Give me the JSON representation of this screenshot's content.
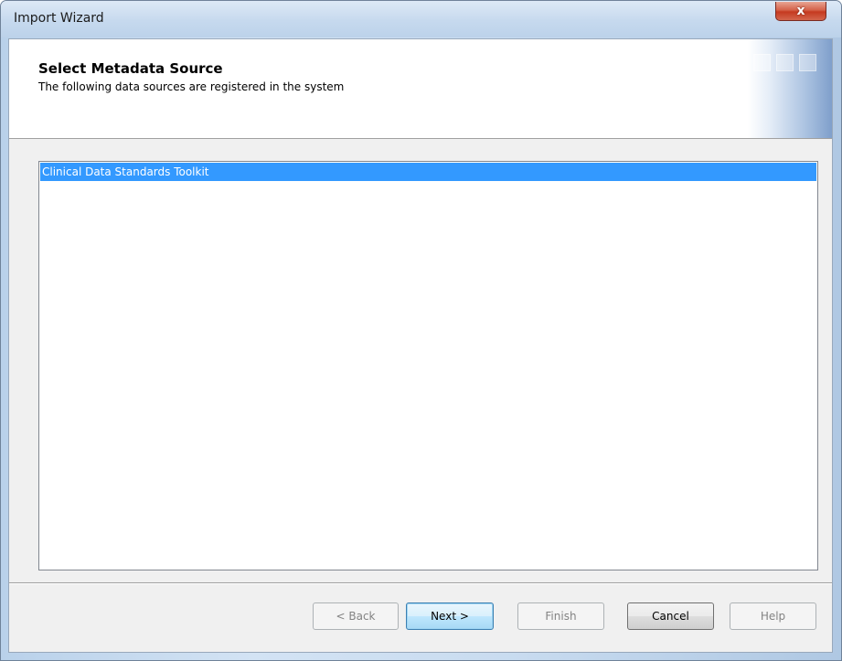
{
  "window": {
    "title": "Import Wizard",
    "close_glyph": "x"
  },
  "header": {
    "title": "Select Metadata Source",
    "subtitle": "The following data sources are registered in the system"
  },
  "sources": {
    "items": [
      {
        "label": "Clinical Data Standards Toolkit",
        "selected": true
      }
    ]
  },
  "buttons": {
    "back": {
      "label": "< Back",
      "enabled": false
    },
    "next": {
      "label": "Next >",
      "enabled": true,
      "default": true
    },
    "finish": {
      "label": "Finish",
      "enabled": false
    },
    "cancel": {
      "label": "Cancel",
      "enabled": true
    },
    "help": {
      "label": "Help",
      "enabled": false
    }
  },
  "colors": {
    "selection": "#3399ff",
    "close_button": "#c53a20"
  }
}
